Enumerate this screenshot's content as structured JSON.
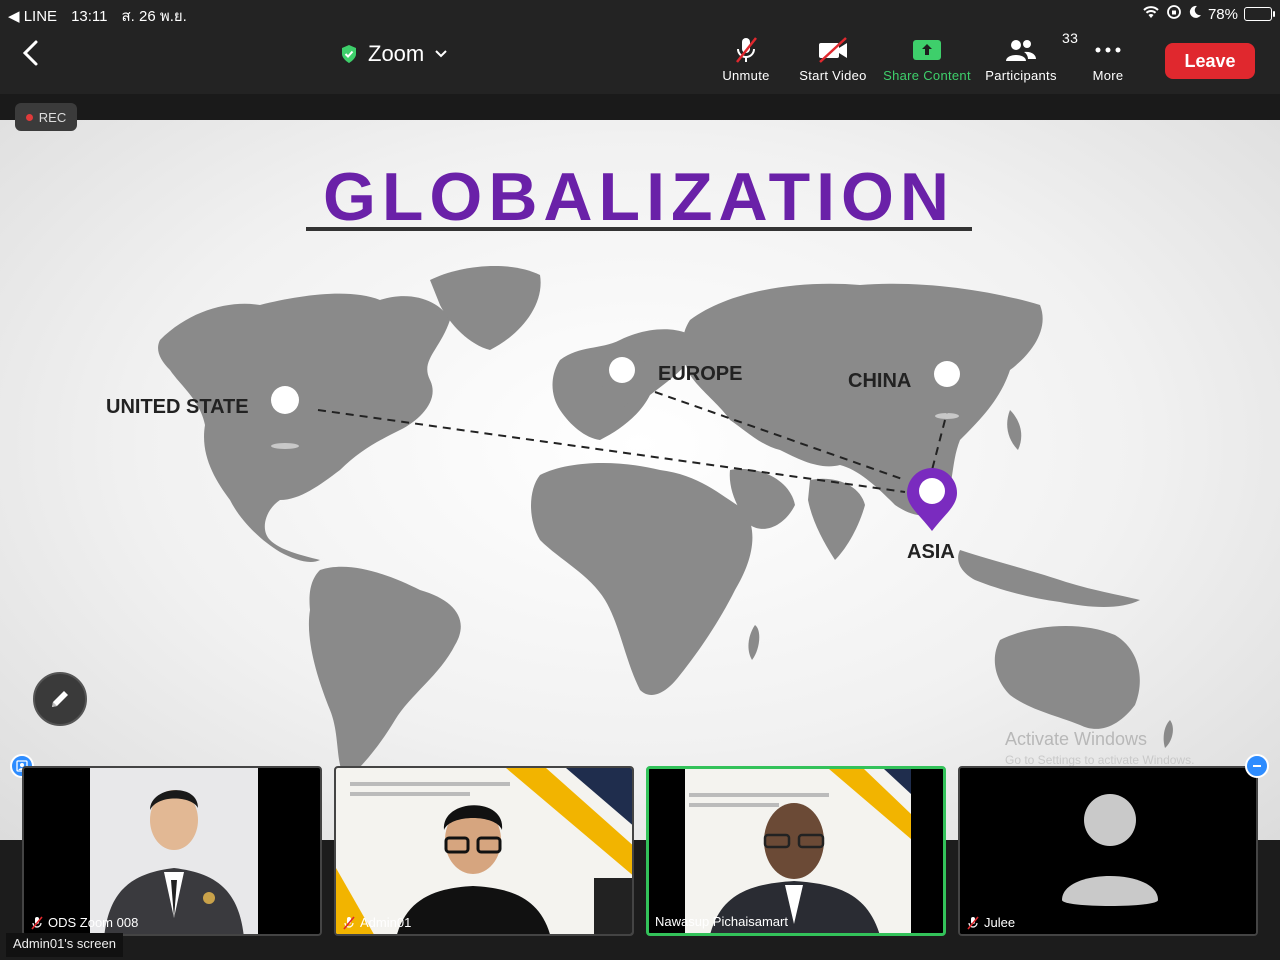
{
  "status": {
    "back_app": "◀ LINE",
    "time": "13:11",
    "date": "ส. 26 พ.ย.",
    "battery": "78%",
    "battery_level": 0.78
  },
  "toolbar": {
    "meeting_title": "Zoom",
    "unmute": "Unmute",
    "start_video": "Start Video",
    "share_content": "Share Content",
    "participants": "Participants",
    "participants_count": "33",
    "more": "More",
    "leave": "Leave"
  },
  "rec_label": "REC",
  "slide": {
    "title": "GLOBALIZATION",
    "pins": {
      "united_state": "UNITED STATE",
      "europe": "EUROPE",
      "china": "CHINA",
      "asia": "ASIA"
    },
    "watermark_line1": "Activate Windows",
    "watermark_line2": "Go to Settings to activate Windows."
  },
  "participants": [
    {
      "name": "ODS Zoom 008",
      "muted": true
    },
    {
      "name": "Admin01",
      "muted": true
    },
    {
      "name": "Nawasup Pichaisamart",
      "muted": false
    },
    {
      "name": "Julee",
      "muted": true
    }
  ],
  "screen_label": "Admin01's screen",
  "colors": {
    "leave": "#e0282e",
    "share_green": "#3ecf6b",
    "active_speaker": "#33c25a",
    "title_purple": "#6a21a8"
  }
}
